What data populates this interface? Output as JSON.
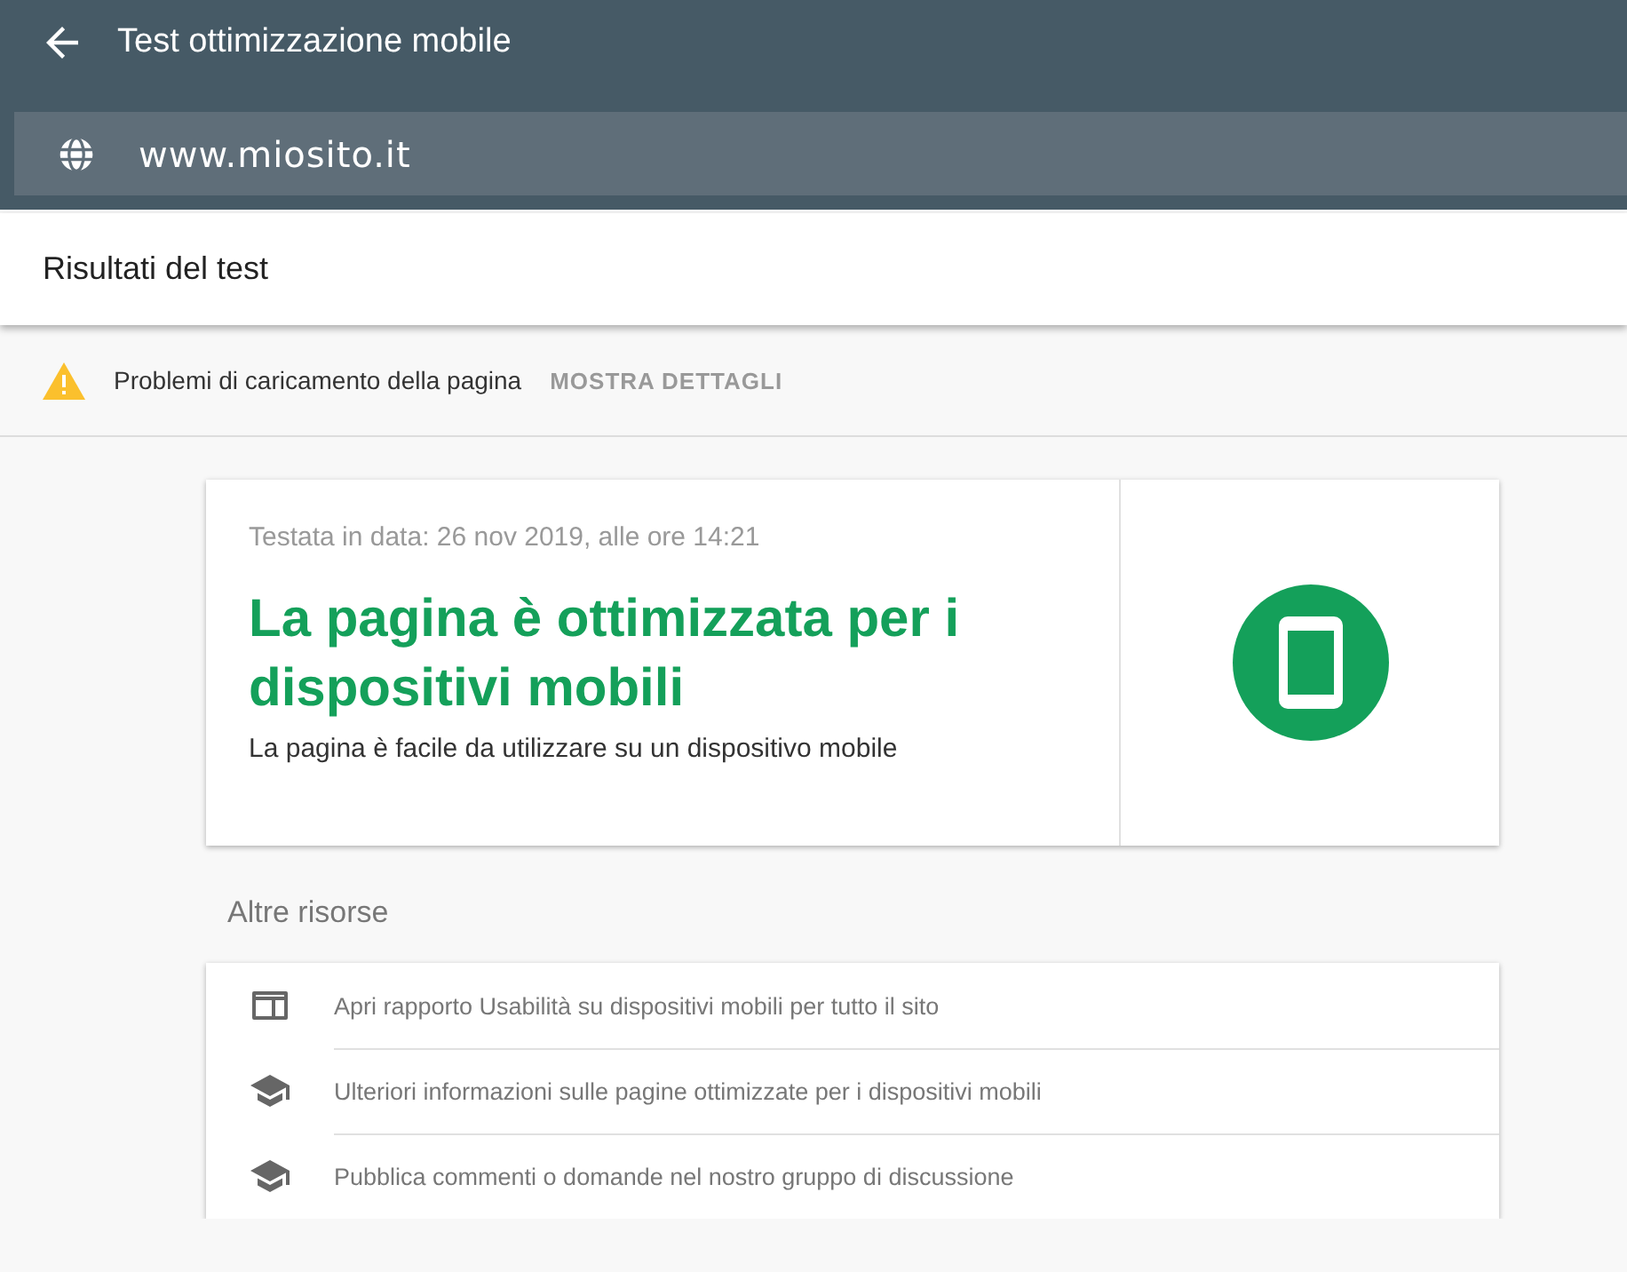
{
  "app_bar": {
    "title": "Test ottimizzazione mobile"
  },
  "url_field": {
    "value": "www.miosito.it"
  },
  "section_title": "Risultati del test",
  "warning": {
    "message": "Problemi di caricamento della pagina",
    "action": "MOSTRA DETTAGLI"
  },
  "result": {
    "tested_on": "Testata in data: 26 nov 2019, alle ore 14:21",
    "headline": "La pagina è ottimizzata per i dispositivi mobili",
    "description": "La pagina è facile da utilizzare su un dispositivo mobile"
  },
  "resources": {
    "title": "Altre risorse",
    "items": [
      {
        "kind": "dashboard",
        "label": "Apri rapporto Usabilità su dispositivi mobili per tutto il sito"
      },
      {
        "kind": "school",
        "label": "Ulteriori informazioni sulle pagine ottimizzate per i dispositivi mobili"
      },
      {
        "kind": "school",
        "label": "Pubblica commenti o domande nel nostro gruppo di discussione"
      }
    ]
  }
}
